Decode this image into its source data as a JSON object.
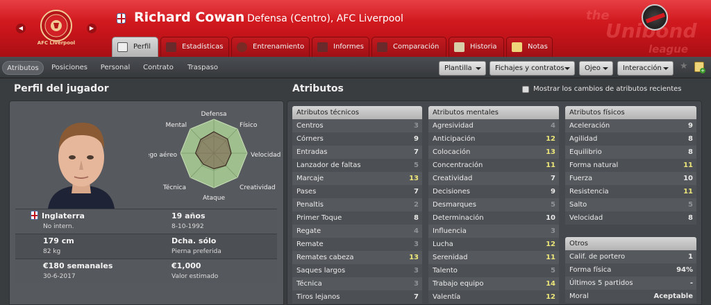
{
  "header": {
    "player_name": "Richard Cowan",
    "player_sub": "Defensa (Centro), AFC Liverpool",
    "club_crest_caption": "AFC Liverpool",
    "league_logo_line1": "the",
    "league_logo_line2": "Unibond",
    "league_logo_line3": "league"
  },
  "tabs": [
    {
      "label": "Perfil",
      "active": true
    },
    {
      "label": "Estadísticas",
      "active": false
    },
    {
      "label": "Entrenamiento",
      "active": false
    },
    {
      "label": "Informes",
      "active": false
    },
    {
      "label": "Comparación",
      "active": false
    },
    {
      "label": "Historia",
      "active": false
    },
    {
      "label": "Notas",
      "active": false
    }
  ],
  "subtabs": [
    {
      "label": "Atributos",
      "active": true
    },
    {
      "label": "Posiciones",
      "active": false
    },
    {
      "label": "Personal",
      "active": false
    },
    {
      "label": "Contrato",
      "active": false
    },
    {
      "label": "Traspaso",
      "active": false
    }
  ],
  "dropdowns": [
    {
      "label": "Plantilla"
    },
    {
      "label": "Fichajes y contratos"
    },
    {
      "label": "Ojeo"
    },
    {
      "label": "Interacción"
    }
  ],
  "profile": {
    "title": "Perfil del jugador",
    "radar_labels": {
      "defensa": "Defensa",
      "fisico": "Físico",
      "velocidad": "Velocidad",
      "creatividad": "Creatividad",
      "ataque": "Ataque",
      "tecnica": "Técnica",
      "juego_aereo": "Juego aéreo",
      "mental": "Mental"
    },
    "radar_values": {
      "defensa": 0.62,
      "fisico": 0.58,
      "velocidad": 0.52,
      "creatividad": 0.5,
      "ataque": 0.45,
      "tecnica": 0.45,
      "juego_aereo": 0.55,
      "mental": 0.56
    },
    "nationality": "Inglaterra",
    "international": "No intern.",
    "age": "19 años",
    "birth_date": "8-10-1992",
    "height": "179 cm",
    "weight": "82 kg",
    "foot": "Dcha. sólo",
    "foot_label": "Pierna preferida",
    "wage": "€180 semanales",
    "contract_end": "30-6-2017",
    "value": "€1,000",
    "value_label": "Valor estimado"
  },
  "attributes": {
    "title": "Atributos",
    "show_changes_label": "Mostrar los cambios de atributos recientes",
    "technical": {
      "header": "Atributos técnicos",
      "items": [
        {
          "name": "Centros",
          "value": "3"
        },
        {
          "name": "Córners",
          "value": "9"
        },
        {
          "name": "Entradas",
          "value": "7"
        },
        {
          "name": "Lanzador de faltas",
          "value": "5"
        },
        {
          "name": "Marcaje",
          "value": "13"
        },
        {
          "name": "Pases",
          "value": "7"
        },
        {
          "name": "Penaltis",
          "value": "2"
        },
        {
          "name": "Primer Toque",
          "value": "8"
        },
        {
          "name": "Regate",
          "value": "4"
        },
        {
          "name": "Remate",
          "value": "3"
        },
        {
          "name": "Remates cabeza",
          "value": "13"
        },
        {
          "name": "Saques largos",
          "value": "3"
        },
        {
          "name": "Técnica",
          "value": "3"
        },
        {
          "name": "Tiros lejanos",
          "value": "7"
        }
      ]
    },
    "mental": {
      "header": "Atributos mentales",
      "items": [
        {
          "name": "Agresividad",
          "value": "4"
        },
        {
          "name": "Anticipación",
          "value": "12"
        },
        {
          "name": "Colocación",
          "value": "13"
        },
        {
          "name": "Concentración",
          "value": "11"
        },
        {
          "name": "Creatividad",
          "value": "7"
        },
        {
          "name": "Decisiones",
          "value": "9"
        },
        {
          "name": "Desmarques",
          "value": "5"
        },
        {
          "name": "Determinación",
          "value": "10"
        },
        {
          "name": "Influencia",
          "value": "3"
        },
        {
          "name": "Lucha",
          "value": "12"
        },
        {
          "name": "Serenidad",
          "value": "11"
        },
        {
          "name": "Talento",
          "value": "5"
        },
        {
          "name": "Trabajo equipo",
          "value": "14"
        },
        {
          "name": "Valentía",
          "value": "12"
        }
      ]
    },
    "physical": {
      "header": "Atributos físicos",
      "items": [
        {
          "name": "Aceleración",
          "value": "9"
        },
        {
          "name": "Agilidad",
          "value": "8"
        },
        {
          "name": "Equilibrio",
          "value": "8"
        },
        {
          "name": "Forma natural",
          "value": "11"
        },
        {
          "name": "Fuerza",
          "value": "10"
        },
        {
          "name": "Resistencia",
          "value": "11"
        },
        {
          "name": "Salto",
          "value": "5"
        },
        {
          "name": "Velocidad",
          "value": "8"
        }
      ]
    },
    "other": {
      "header": "Otros",
      "items": [
        {
          "name": "Calif. de portero",
          "value": "1"
        },
        {
          "name": "Forma física",
          "value": "94%"
        },
        {
          "name": "Últimos 5 partidos",
          "value": "-"
        },
        {
          "name": "Moral",
          "value": "Aceptable"
        }
      ]
    }
  },
  "colors": {
    "header_red": "#c8151b",
    "value_high": "#ece67a",
    "value_low": "#8f9296",
    "panel_bg": "#45484c"
  }
}
